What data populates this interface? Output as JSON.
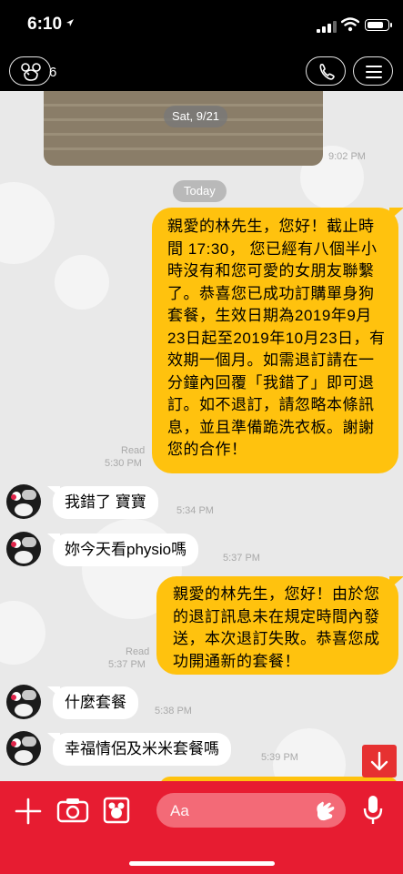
{
  "status_bar": {
    "time": "6:10",
    "battery_level": 0.85
  },
  "header": {
    "chat_name": "6",
    "icons": [
      "back-mickey-icon",
      "phone-icon",
      "menu-icon"
    ]
  },
  "chat": {
    "photo_date": "Sat, 9/21",
    "photo_time": "9:02 PM",
    "today_label": "Today",
    "messages": [
      {
        "from": "me",
        "text": "親愛的林先生，您好！截止時間 17:30， 您已經有八個半小時沒有和您可愛的女朋友聯繫了。恭喜您已成功訂購單身狗套餐，生效日期為2019年9月23日起至2019年10月23日，有效期一個月。如需退訂請在一分鐘內回覆「我錯了」即可退訂。如不退訂，請忽略本條訊息，並且準備跪洗衣板。謝謝您的合作！",
        "read": "Read",
        "time": "5:30 PM"
      },
      {
        "from": "them",
        "text": "我錯了 寶寶",
        "time": "5:34 PM"
      },
      {
        "from": "them",
        "text": "妳今天看physio嗎",
        "time": "5:37 PM"
      },
      {
        "from": "me",
        "text": "親愛的林先生，您好！由於您的退訂訊息未在規定時間內發送，本次退訂失敗。恭喜您成功開通新的套餐！",
        "read": "Read",
        "time": "5:37 PM"
      },
      {
        "from": "them",
        "text": "什麼套餐",
        "time": "5:38 PM"
      },
      {
        "from": "them",
        "text": "幸福情侶及米米套餐嗎",
        "time": "5:39 PM"
      }
    ]
  },
  "bottom_bar": {
    "placeholder": "Aa",
    "icons": [
      "plus-icon",
      "camera-icon",
      "gallery-icon",
      "sticker-icon",
      "mic-icon"
    ]
  },
  "colors": {
    "accent": "#e71c31",
    "out_bubble": "#ffc20e",
    "in_bubble": "#ffffff",
    "chat_bg": "#e9e9e9"
  }
}
